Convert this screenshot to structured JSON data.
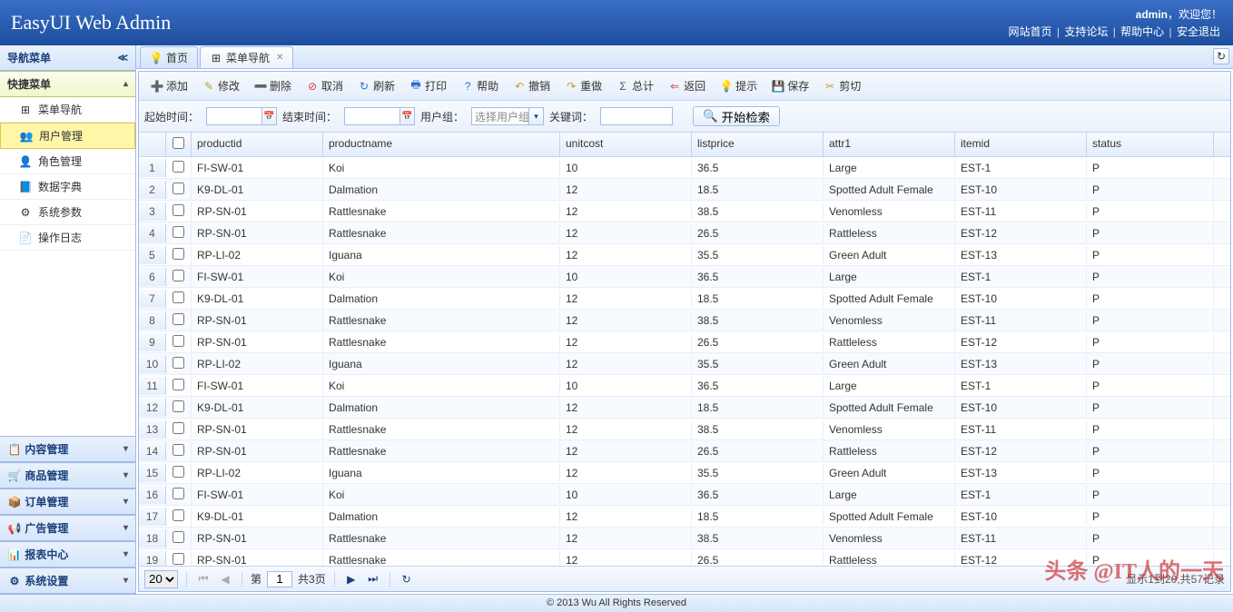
{
  "header": {
    "title": "EasyUI Web Admin",
    "user": "admin",
    "welcome": "，欢迎您！",
    "links": [
      "网站首页",
      "支持论坛",
      "帮助中心",
      "安全退出"
    ]
  },
  "sidebar": {
    "title": "导航菜单",
    "accordion": [
      {
        "title": "快捷菜单",
        "expanded": true,
        "items": [
          {
            "icon": "tree-icon",
            "label": "菜单导航",
            "selected": false
          },
          {
            "icon": "users-icon",
            "label": "用户管理",
            "selected": true
          },
          {
            "icon": "role-icon",
            "label": "角色管理",
            "selected": false
          },
          {
            "icon": "dict-icon",
            "label": "数据字典",
            "selected": false
          },
          {
            "icon": "gear-icon",
            "label": "系统参数",
            "selected": false
          },
          {
            "icon": "log-icon",
            "label": "操作日志",
            "selected": false
          }
        ]
      },
      {
        "title": "内容管理",
        "expanded": false
      },
      {
        "title": "商品管理",
        "expanded": false
      },
      {
        "title": "订单管理",
        "expanded": false
      },
      {
        "title": "广告管理",
        "expanded": false
      },
      {
        "title": "报表中心",
        "expanded": false
      },
      {
        "title": "系统设置",
        "expanded": false
      }
    ]
  },
  "tabs": [
    {
      "label": "首页",
      "closable": false,
      "icon": "lightbulb-icon"
    },
    {
      "label": "菜单导航",
      "closable": true,
      "icon": "tree-icon",
      "active": true
    }
  ],
  "toolbar": [
    {
      "icon": "add-icon",
      "color": "#2b9f2b",
      "label": "添加"
    },
    {
      "icon": "edit-icon",
      "color": "#c59b2e",
      "label": "修改"
    },
    {
      "icon": "delete-icon",
      "color": "#d04040",
      "label": "删除"
    },
    {
      "icon": "cancel-icon",
      "color": "#d04040",
      "label": "取消"
    },
    {
      "icon": "refresh-icon",
      "color": "#2b6fd0",
      "label": "刷新"
    },
    {
      "icon": "print-icon",
      "color": "#2b6fd0",
      "label": "打印"
    },
    {
      "icon": "help-icon",
      "color": "#2b6fd0",
      "label": "帮助"
    },
    {
      "icon": "undo-icon",
      "color": "#c59b2e",
      "label": "撤销"
    },
    {
      "icon": "redo-icon",
      "color": "#c59b2e",
      "label": "重做"
    },
    {
      "icon": "sum-icon",
      "color": "#555",
      "label": "总计"
    },
    {
      "icon": "back-icon",
      "color": "#d04040",
      "label": "返回"
    },
    {
      "icon": "tip-icon",
      "color": "#e0c030",
      "label": "提示"
    },
    {
      "icon": "save-icon",
      "color": "#2b6fd0",
      "label": "保存"
    },
    {
      "icon": "cut-icon",
      "color": "#c59b2e",
      "label": "剪切"
    }
  ],
  "search": {
    "startLabel": "起始时间：",
    "endLabel": "结束时间：",
    "groupLabel": "用户组：",
    "groupPlaceholder": "选择用户组",
    "keywordLabel": "关键词：",
    "submitLabel": "开始检索"
  },
  "grid": {
    "columns": [
      "productid",
      "productname",
      "unitcost",
      "listprice",
      "attr1",
      "itemid",
      "status"
    ],
    "rows": [
      {
        "productid": "FI-SW-01",
        "productname": "Koi",
        "unitcost": "10",
        "listprice": "36.5",
        "attr1": "Large",
        "itemid": "EST-1",
        "status": "P"
      },
      {
        "productid": "K9-DL-01",
        "productname": "Dalmation",
        "unitcost": "12",
        "listprice": "18.5",
        "attr1": "Spotted Adult Female",
        "itemid": "EST-10",
        "status": "P"
      },
      {
        "productid": "RP-SN-01",
        "productname": "Rattlesnake",
        "unitcost": "12",
        "listprice": "38.5",
        "attr1": "Venomless",
        "itemid": "EST-11",
        "status": "P"
      },
      {
        "productid": "RP-SN-01",
        "productname": "Rattlesnake",
        "unitcost": "12",
        "listprice": "26.5",
        "attr1": "Rattleless",
        "itemid": "EST-12",
        "status": "P"
      },
      {
        "productid": "RP-LI-02",
        "productname": "Iguana",
        "unitcost": "12",
        "listprice": "35.5",
        "attr1": "Green Adult",
        "itemid": "EST-13",
        "status": "P"
      },
      {
        "productid": "FI-SW-01",
        "productname": "Koi",
        "unitcost": "10",
        "listprice": "36.5",
        "attr1": "Large",
        "itemid": "EST-1",
        "status": "P"
      },
      {
        "productid": "K9-DL-01",
        "productname": "Dalmation",
        "unitcost": "12",
        "listprice": "18.5",
        "attr1": "Spotted Adult Female",
        "itemid": "EST-10",
        "status": "P"
      },
      {
        "productid": "RP-SN-01",
        "productname": "Rattlesnake",
        "unitcost": "12",
        "listprice": "38.5",
        "attr1": "Venomless",
        "itemid": "EST-11",
        "status": "P"
      },
      {
        "productid": "RP-SN-01",
        "productname": "Rattlesnake",
        "unitcost": "12",
        "listprice": "26.5",
        "attr1": "Rattleless",
        "itemid": "EST-12",
        "status": "P"
      },
      {
        "productid": "RP-LI-02",
        "productname": "Iguana",
        "unitcost": "12",
        "listprice": "35.5",
        "attr1": "Green Adult",
        "itemid": "EST-13",
        "status": "P"
      },
      {
        "productid": "FI-SW-01",
        "productname": "Koi",
        "unitcost": "10",
        "listprice": "36.5",
        "attr1": "Large",
        "itemid": "EST-1",
        "status": "P"
      },
      {
        "productid": "K9-DL-01",
        "productname": "Dalmation",
        "unitcost": "12",
        "listprice": "18.5",
        "attr1": "Spotted Adult Female",
        "itemid": "EST-10",
        "status": "P"
      },
      {
        "productid": "RP-SN-01",
        "productname": "Rattlesnake",
        "unitcost": "12",
        "listprice": "38.5",
        "attr1": "Venomless",
        "itemid": "EST-11",
        "status": "P"
      },
      {
        "productid": "RP-SN-01",
        "productname": "Rattlesnake",
        "unitcost": "12",
        "listprice": "26.5",
        "attr1": "Rattleless",
        "itemid": "EST-12",
        "status": "P"
      },
      {
        "productid": "RP-LI-02",
        "productname": "Iguana",
        "unitcost": "12",
        "listprice": "35.5",
        "attr1": "Green Adult",
        "itemid": "EST-13",
        "status": "P"
      },
      {
        "productid": "FI-SW-01",
        "productname": "Koi",
        "unitcost": "10",
        "listprice": "36.5",
        "attr1": "Large",
        "itemid": "EST-1",
        "status": "P"
      },
      {
        "productid": "K9-DL-01",
        "productname": "Dalmation",
        "unitcost": "12",
        "listprice": "18.5",
        "attr1": "Spotted Adult Female",
        "itemid": "EST-10",
        "status": "P"
      },
      {
        "productid": "RP-SN-01",
        "productname": "Rattlesnake",
        "unitcost": "12",
        "listprice": "38.5",
        "attr1": "Venomless",
        "itemid": "EST-11",
        "status": "P"
      },
      {
        "productid": "RP-SN-01",
        "productname": "Rattlesnake",
        "unitcost": "12",
        "listprice": "26.5",
        "attr1": "Rattleless",
        "itemid": "EST-12",
        "status": "P"
      }
    ]
  },
  "pager": {
    "pageSize": "20",
    "pageLabelPrefix": "第",
    "page": "1",
    "pageLabelSuffix": "共3页",
    "info": "显示1到20,共57记录"
  },
  "footer": "© 2013 Wu All Rights Reserved",
  "watermark": "头条 @IT人的一天",
  "icons": {
    "tree-icon": "⊞",
    "users-icon": "👥",
    "role-icon": "👤",
    "dict-icon": "📘",
    "gear-icon": "⚙",
    "log-icon": "📄",
    "lightbulb-icon": "💡",
    "add-icon": "➕",
    "edit-icon": "✎",
    "delete-icon": "➖",
    "cancel-icon": "⊘",
    "refresh-icon": "↻",
    "print-icon": "🖶",
    "help-icon": "?",
    "undo-icon": "↶",
    "redo-icon": "↷",
    "sum-icon": "Σ",
    "back-icon": "⇐",
    "tip-icon": "💡",
    "save-icon": "💾",
    "cut-icon": "✂",
    "search-icon": "🔍",
    "calendar-icon": "📅",
    "content-icon": "📋",
    "product-icon": "🛒",
    "order-icon": "📦",
    "ad-icon": "📢",
    "report-icon": "📊"
  }
}
